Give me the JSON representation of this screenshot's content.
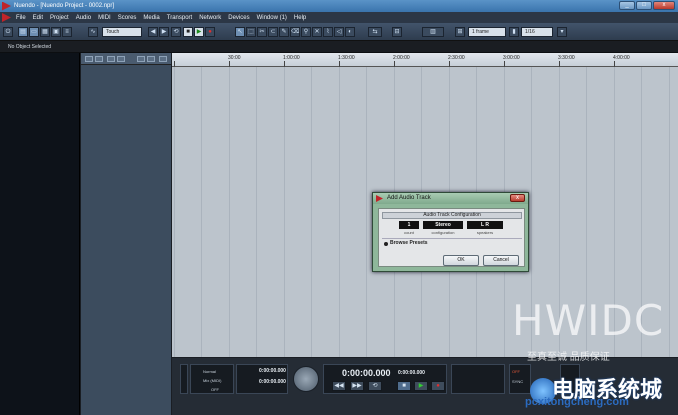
{
  "window": {
    "title": "Nuendo - [Nuendo Project - 0002.npr]",
    "minimize": "_",
    "maximize": "□",
    "close": "x"
  },
  "menu": [
    "File",
    "Edit",
    "Project",
    "Audio",
    "MIDI",
    "Scores",
    "Media",
    "Transport",
    "Network",
    "Devices",
    "Window (1)",
    "Help"
  ],
  "toolbar": {
    "automation_mode": "Touch",
    "grid_mode": "1 frame",
    "quantize": "1/16"
  },
  "info_line": "No Object Selected",
  "ruler": {
    "labels": [
      "30:00",
      "1:00:00",
      "1:30:00",
      "2:00:00",
      "2:30:00",
      "3:00:00",
      "3:30:00",
      "4:00:00"
    ]
  },
  "dialog": {
    "title": "Add Audio Track",
    "close": "x",
    "section_header": "Audio Track Configuration",
    "count_value": "1",
    "count_label": "count",
    "configuration_value": "Stereo",
    "configuration_label": "configuration",
    "speakers_value": "L R",
    "speakers_label": "speakers",
    "browse_presets": "Browse Presets",
    "ok": "OK",
    "cancel": "Cancel"
  },
  "transport": {
    "mode": "Normal",
    "midi_label": "Mix (MIDI)",
    "off_label": "OFF",
    "left_time_1": "0:00:00.000",
    "left_time_2": "0:00:00.000",
    "main_time": "0:00:00.000",
    "secondary_time": "0:00:00.000",
    "sync_off": "OFF",
    "sync_label": "SYNC"
  },
  "watermark": {
    "brand": "HWIDC",
    "slogan": "至真至诚 品质保证",
    "site_cn": "电脑系统城",
    "site_url": "pcxitongcheng.com"
  },
  "colors": {
    "titlebar": "#3a74ad",
    "dialog_bg": "#8eb79a",
    "event_area": "#bcc4cc"
  }
}
